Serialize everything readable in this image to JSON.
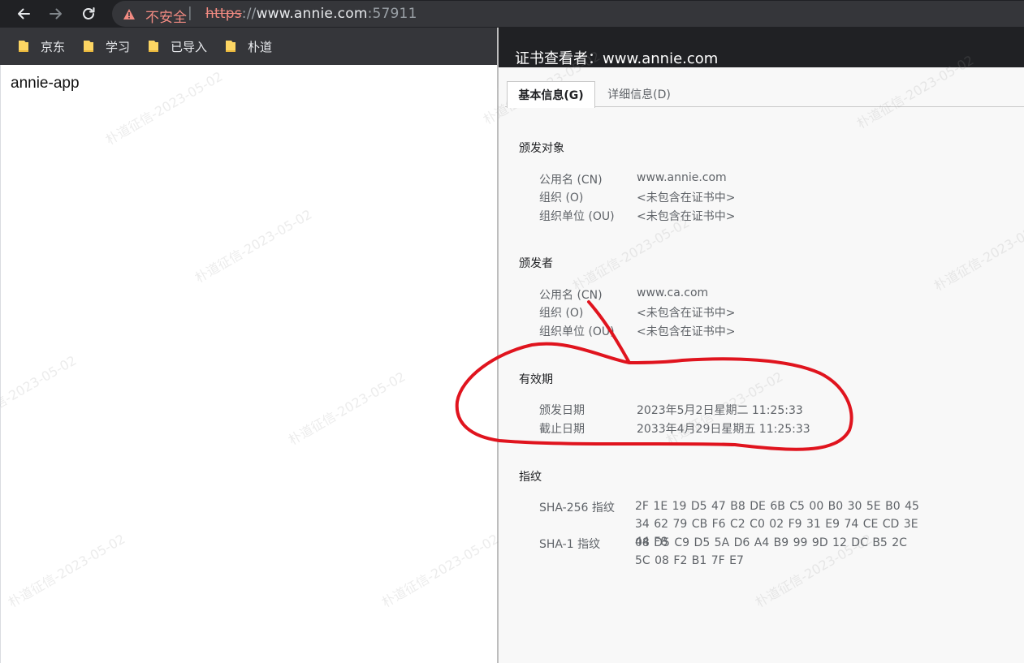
{
  "browser": {
    "security_warning": "不安全",
    "separator": "|",
    "url_scheme": "https",
    "url_after_scheme": "://",
    "url_host": "www.annie.com",
    "url_port": ":57911"
  },
  "bookmarks": [
    {
      "label": "京东"
    },
    {
      "label": "学习"
    },
    {
      "label": "已导入"
    },
    {
      "label": "朴道"
    }
  ],
  "page": {
    "text": "annie-app"
  },
  "certificate": {
    "title": "证书查看者：www.annie.com",
    "tabs": [
      {
        "label": "基本信息(G)",
        "active": true
      },
      {
        "label": "详细信息(D)",
        "active": false
      }
    ],
    "issued_to": {
      "title": "颁发对象",
      "rows": [
        {
          "label": "公用名 (CN)",
          "value": "www.annie.com"
        },
        {
          "label": "组织 (O)",
          "value": "<未包含在证书中>"
        },
        {
          "label": "组织单位 (OU)",
          "value": "<未包含在证书中>"
        }
      ]
    },
    "issued_by": {
      "title": "颁发者",
      "rows": [
        {
          "label": "公用名 (CN)",
          "value": "www.ca.com"
        },
        {
          "label": "组织 (O)",
          "value": "<未包含在证书中>"
        },
        {
          "label": "组织单位 (OU)",
          "value": "<未包含在证书中>"
        }
      ]
    },
    "validity": {
      "title": "有效期",
      "rows": [
        {
          "label": "颁发日期",
          "value": "2023年5月2日星期二 11:25:33"
        },
        {
          "label": "截止日期",
          "value": "2033年4月29日星期五 11:25:33"
        }
      ]
    },
    "fingerprints": {
      "title": "指纹",
      "rows": [
        {
          "label": "SHA-256 指纹",
          "value": "2F 1E 19 D5 47 B8 DE 6B C5 00 B0 30 5E B0 45 34 62 79 CB F6 C2 C0 02 F9 31 E9 74 CE CD 3E 44 F8"
        },
        {
          "label": "SHA-1 指纹",
          "value": "08 D5 C9 D5 5A D6 A4 B9 99 9D 12 DC B5 2C 5C 08 F2 B1 7F E7"
        }
      ]
    }
  },
  "watermark": "朴道征信-2023-05-02",
  "colors": {
    "chrome_dark": "#202124",
    "omnibox": "#35363a",
    "warning": "#f28b82",
    "annotation": "#e0141e"
  }
}
